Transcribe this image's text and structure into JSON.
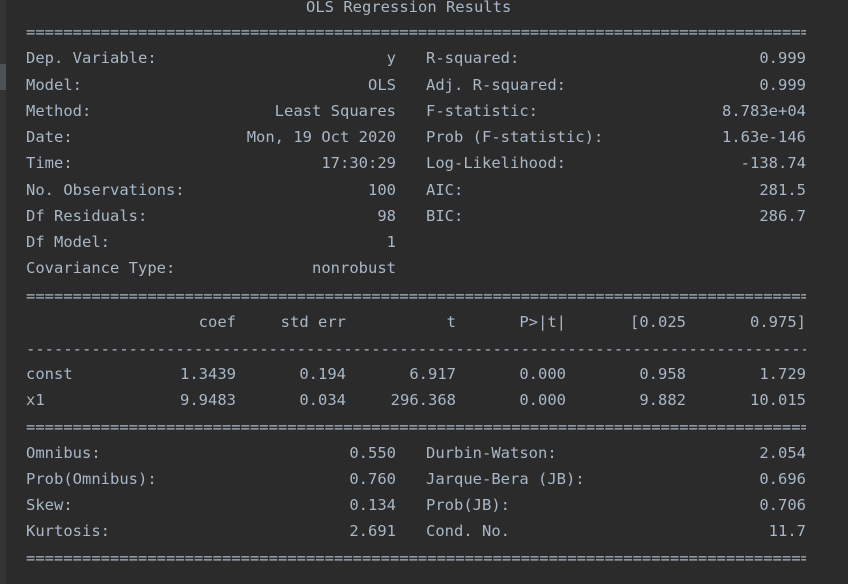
{
  "title": "OLS Regression Results",
  "separators": {
    "double": "=========================================================================================",
    "single": "-----------------------------------------------------------------------------------------"
  },
  "model_info_left": [
    {
      "label": "Dep. Variable:",
      "value": "y"
    },
    {
      "label": "Model:",
      "value": "OLS"
    },
    {
      "label": "Method:",
      "value": "Least Squares"
    },
    {
      "label": "Date:",
      "value": "Mon, 19 Oct 2020"
    },
    {
      "label": "Time:",
      "value": "17:30:29"
    },
    {
      "label": "No. Observations:",
      "value": "100"
    },
    {
      "label": "Df Residuals:",
      "value": "98"
    },
    {
      "label": "Df Model:",
      "value": "1"
    },
    {
      "label": "Covariance Type:",
      "value": "nonrobust"
    }
  ],
  "model_info_right": [
    {
      "label": "R-squared:",
      "value": "0.999"
    },
    {
      "label": "Adj. R-squared:",
      "value": "0.999"
    },
    {
      "label": "F-statistic:",
      "value": "8.783e+04"
    },
    {
      "label": "Prob (F-statistic):",
      "value": "1.63e-146"
    },
    {
      "label": "Log-Likelihood:",
      "value": "-138.74"
    },
    {
      "label": "AIC:",
      "value": "281.5"
    },
    {
      "label": "BIC:",
      "value": "286.7"
    }
  ],
  "coef_table": {
    "headers": [
      "coef",
      "std err",
      "t",
      "P>|t|",
      "[0.025",
      "0.975]"
    ],
    "rows": [
      {
        "name": "const",
        "values": [
          "1.3439",
          "0.194",
          "6.917",
          "0.000",
          "0.958",
          "1.729"
        ]
      },
      {
        "name": "x1",
        "values": [
          "9.9483",
          "0.034",
          "296.368",
          "0.000",
          "9.882",
          "10.015"
        ]
      }
    ]
  },
  "diagnostics_left": [
    {
      "label": "Omnibus:",
      "value": "0.550"
    },
    {
      "label": "Prob(Omnibus):",
      "value": "0.760"
    },
    {
      "label": "Skew:",
      "value": "0.134"
    },
    {
      "label": "Kurtosis:",
      "value": "2.691"
    }
  ],
  "diagnostics_right": [
    {
      "label": "Durbin-Watson:",
      "value": "2.054"
    },
    {
      "label": "Jarque-Bera (JB):",
      "value": "0.696"
    },
    {
      "label": "Prob(JB):",
      "value": "0.706"
    },
    {
      "label": "Cond. No.",
      "value": "11.7"
    }
  ]
}
